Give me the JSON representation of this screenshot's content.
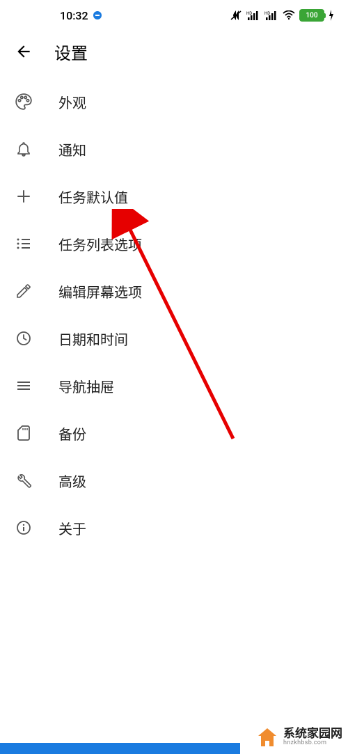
{
  "status": {
    "time": "10:32",
    "battery": "100"
  },
  "header": {
    "title": "设置"
  },
  "items": [
    {
      "icon": "palette",
      "label": "外观"
    },
    {
      "icon": "bell",
      "label": "通知"
    },
    {
      "icon": "plus",
      "label": "任务默认值"
    },
    {
      "icon": "list",
      "label": "任务列表选项"
    },
    {
      "icon": "pencil",
      "label": "编辑屏幕选项"
    },
    {
      "icon": "clock",
      "label": "日期和时间"
    },
    {
      "icon": "drawer",
      "label": "导航抽屉"
    },
    {
      "icon": "sdcard",
      "label": "备份"
    },
    {
      "icon": "wrench",
      "label": "高级"
    },
    {
      "icon": "info",
      "label": "关于"
    }
  ],
  "brand": {
    "cn": "系统家园网",
    "en": "hnzkhbsb.com"
  }
}
